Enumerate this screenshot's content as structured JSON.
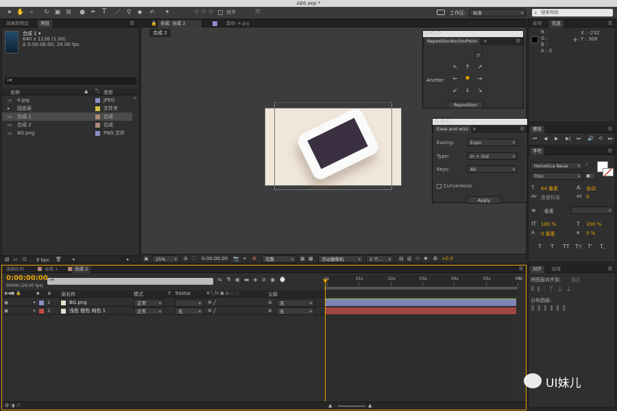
{
  "window_title": "AE6.aep *",
  "toolbar": {
    "align_label": "对齐",
    "workspace_label": "工作区:",
    "workspace_value": "标准",
    "search_placeholder": "搜索帮助"
  },
  "project_panel": {
    "tabs": [
      "效果和预设",
      "项目"
    ],
    "comp_name": "合成 1 ▾",
    "comp_size": "640 x 1136 (1.00)",
    "comp_duration": "Δ 0:00:06:00, 29.00 fps",
    "col_name": "名称",
    "col_type": "类型",
    "items": [
      {
        "name": "4.jpg",
        "type": "JPEG",
        "color": "#8a8fc8"
      },
      {
        "name": "固态层",
        "type": "文件夹",
        "color": "#d6c24a"
      },
      {
        "name": "合成 1",
        "type": "合成",
        "color": "#b08a7a"
      },
      {
        "name": "合成 2",
        "type": "合成",
        "color": "#b08a7a"
      },
      {
        "name": "8G.png",
        "type": "PNG 文件",
        "color": "#8a8fc8"
      }
    ],
    "bpc": "8 bpc"
  },
  "comp_viewer": {
    "tabs": [
      "合成: 合成 2",
      "素材: 4.jpg"
    ],
    "sub_tab": "合成 2",
    "zoom": "25%",
    "timecode": "0:00:00:00",
    "resolution": "完整",
    "camera": "活动摄像机",
    "views": "1 个...",
    "exposure": "+0.0"
  },
  "reposition_panel": {
    "title": "RepositionAnchorPoint",
    "help": "?",
    "anchor_label": "Anchor:",
    "button": "Reposition"
  },
  "ease_panel": {
    "title": "Ease and wizz",
    "fields": [
      {
        "label": "Easing:",
        "value": "Expo"
      },
      {
        "label": "Type:",
        "value": "In + Out"
      },
      {
        "label": "Keys:",
        "value": "All"
      }
    ],
    "checkbox": "Curvaceous",
    "apply": "Apply"
  },
  "info_panel": {
    "tabs": [
      "音频",
      "信息"
    ],
    "rgb": [
      "R :",
      "G :",
      "B :",
      "A : 0"
    ],
    "x": "X : -232",
    "y": "Y : 308"
  },
  "preview_panel": {
    "tab": "预览"
  },
  "char_panel": {
    "tab": "字符",
    "font": "Helvetica Neue",
    "style": "Thin",
    "size": "64 像素",
    "leading": "自动",
    "tracking_label": "度量标准",
    "tracking": "0",
    "stroke": "- 像素",
    "vscale": "100 %",
    "hscale": "100 %",
    "baseline": "0 像素",
    "tsume": "0 %",
    "styles": [
      "T",
      "T",
      "TT",
      "Tт",
      "T'",
      "T,"
    ]
  },
  "align_panel": {
    "tabs": [
      "对齐",
      "段落"
    ],
    "align_to_label": "将图层对齐到:",
    "align_to_value": "选区",
    "distribute_label": "分布图层:"
  },
  "timeline": {
    "tabs": [
      "渲染队列",
      "合成 1",
      "合成 2"
    ],
    "timecode": "0:00:00:00",
    "frames": "00000 (29.00 fps)",
    "search_placeholder": "",
    "headers": {
      "num": "#",
      "name": "源名称",
      "mode": "模式",
      "t": "T",
      "trkmat": "TrkMat",
      "parent": "父级"
    },
    "ruler": [
      "0s",
      "01s",
      "02s",
      "03s",
      "04s",
      "05s",
      "06s"
    ],
    "layers": [
      {
        "num": "1",
        "name": "BG.png",
        "mode": "正常",
        "trkmat": "",
        "parent": "无",
        "label_color": "#8a8fc8",
        "bar_color": "#7f84b5"
      },
      {
        "num": "2",
        "name": "浅色 橙色 纯色 1",
        "mode": "正常",
        "trkmat": "无",
        "parent": "无",
        "label_color": "#c84a4a",
        "bar_color": "#a24545"
      }
    ]
  },
  "watermark": "UI妹儿"
}
